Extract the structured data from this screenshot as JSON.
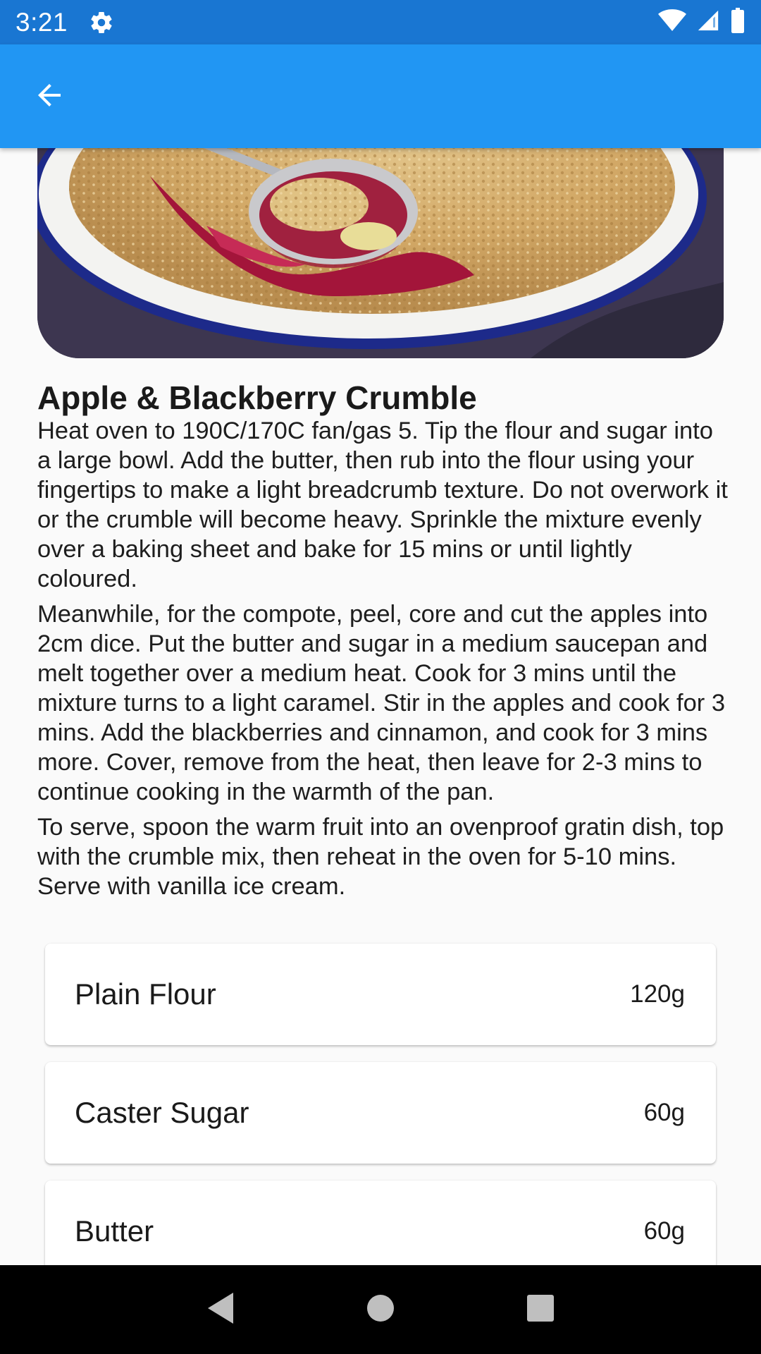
{
  "status_bar": {
    "time": "3:21",
    "icons": [
      "gear-icon",
      "wifi-icon",
      "signal-icon",
      "battery-icon"
    ]
  },
  "app_bar": {
    "back_icon": "arrow-left-icon",
    "color": "#2196f3"
  },
  "recipe": {
    "title": "Apple & Blackberry Crumble",
    "method": [
      "Heat oven to 190C/170C fan/gas 5. Tip the flour and sugar into a large bowl. Add the butter, then rub into the flour using your fingertips to make a light breadcrumb texture. Do not overwork it or the crumble will become heavy. Sprinkle the mixture evenly over a baking sheet and bake for 15 mins or until lightly coloured.",
      "Meanwhile, for the compote, peel, core and cut the apples into 2cm dice. Put the butter and sugar in a medium saucepan and melt together over a medium heat. Cook for 3 mins until the mixture turns to a light caramel. Stir in the apples and cook for 3 mins. Add the blackberries and cinnamon, and cook for 3 mins more. Cover, remove from the heat, then leave for 2-3 mins to continue cooking in the warmth of the pan.",
      "To serve, spoon the warm fruit into an ovenproof gratin dish, top with the crumble mix, then reheat in the oven for 5-10 mins. Serve with vanilla ice cream."
    ],
    "ingredients": [
      {
        "name": "Plain Flour",
        "quantity": "120g"
      },
      {
        "name": "Caster Sugar",
        "quantity": "60g"
      },
      {
        "name": "Butter",
        "quantity": "60g"
      }
    ]
  },
  "nav_bar": {
    "icons": [
      "back-triangle-icon",
      "home-circle-icon",
      "recents-square-icon"
    ]
  }
}
